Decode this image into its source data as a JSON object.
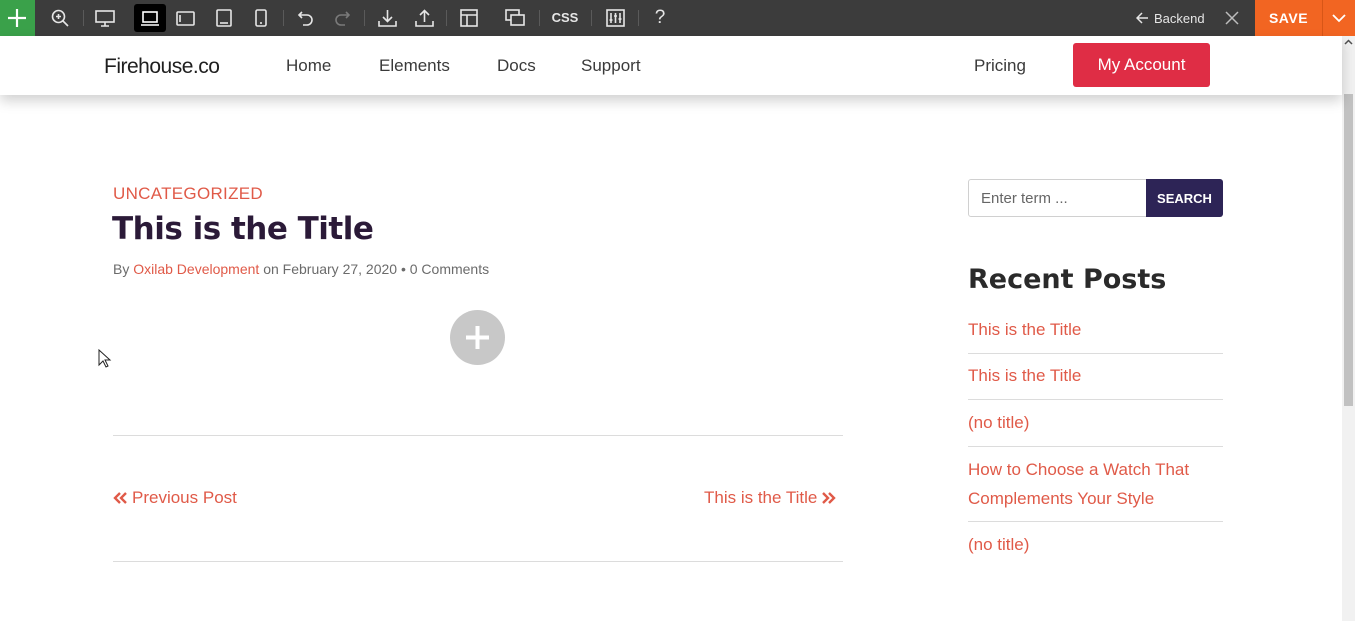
{
  "toolbar": {
    "buttons": [
      {
        "name": "add",
        "icon": "plus-icon"
      },
      {
        "name": "zoom",
        "icon": "zoom-icon"
      },
      {
        "name": "desktop",
        "icon": "desktop-icon"
      },
      {
        "name": "laptop",
        "icon": "laptop-icon",
        "active": true
      },
      {
        "name": "tablet-landscape",
        "icon": "tablet-landscape-icon"
      },
      {
        "name": "tablet-portrait",
        "icon": "tablet-portrait-icon"
      },
      {
        "name": "mobile",
        "icon": "mobile-icon"
      },
      {
        "name": "undo",
        "icon": "undo-icon"
      },
      {
        "name": "redo",
        "icon": "redo-icon",
        "disabled": true
      },
      {
        "name": "download",
        "icon": "download-icon"
      },
      {
        "name": "upload",
        "icon": "upload-icon"
      },
      {
        "name": "layout",
        "icon": "layout-icon"
      },
      {
        "name": "responsive",
        "icon": "responsive-icon"
      },
      {
        "name": "settings",
        "icon": "sliders-icon"
      },
      {
        "name": "help",
        "icon": "help-icon"
      }
    ],
    "css_label": "CSS",
    "help_label": "?",
    "backend_label": "Backend",
    "save_label": "SAVE"
  },
  "site": {
    "logo": "Firehouse.co",
    "nav": [
      "Home",
      "Elements",
      "Docs",
      "Support"
    ],
    "pricing": "Pricing",
    "account": "My Account"
  },
  "post": {
    "category": "UNCATEGORIZED",
    "title": "This is the Title",
    "meta": {
      "by": "By",
      "author": "Oxilab Development",
      "date_prefix": "on",
      "date": "February 27, 2020",
      "bullet": "•",
      "comments": "0 Comments"
    },
    "prev_label": "Previous Post",
    "next_label": "This is the Title"
  },
  "sidebar": {
    "search_placeholder": "Enter term ...",
    "search_button": "SEARCH",
    "widget_title": "Recent Posts",
    "recent_posts": [
      "This is the Title",
      "This is the Title",
      "(no title)",
      "How to Choose a Watch That Complements Your Style",
      "(no title)"
    ]
  },
  "colors": {
    "toolbar_bg": "#3c3c3c",
    "add_green": "#3aa14a",
    "save_orange": "#f26522",
    "account_red": "#df2d45",
    "link_red": "#e05a48",
    "title_purple": "#2b1a38",
    "search_purple": "#2d2456"
  }
}
